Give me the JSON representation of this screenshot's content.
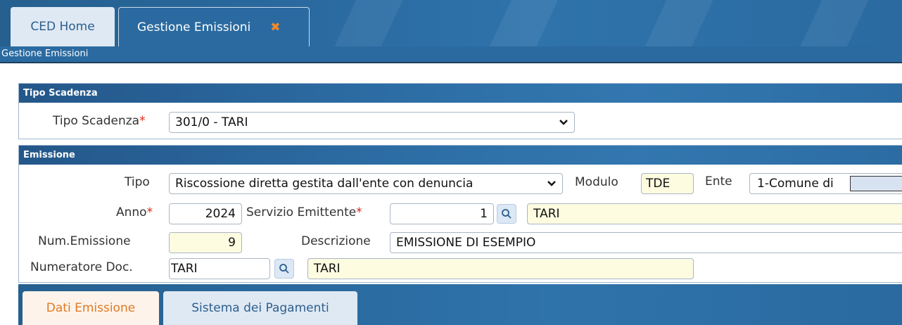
{
  "tabs": {
    "home_label": "CED Home",
    "active_label": "Gestione Emissioni",
    "close_glyph": "✖"
  },
  "breadcrumb": "Gestione Emissioni",
  "tipo_scadenza_panel": {
    "title": "Tipo Scadenza",
    "field_label": "Tipo Scadenza",
    "required_mark": "*",
    "value": "301/0 - TARI"
  },
  "emissione_panel": {
    "title": "Emissione",
    "tipo_label": "Tipo",
    "tipo_value": "Riscossione diretta gestita dall'ente con denuncia",
    "modulo_label": "Modulo",
    "modulo_value": "TDE",
    "ente_label": "Ente",
    "ente_value": "1-Comune di",
    "anno_label": "Anno",
    "anno_value": "2024",
    "servizio_label": "Servizio Emittente",
    "servizio_code": "1",
    "servizio_desc": "TARI",
    "num_label": "Num.Emissione",
    "num_value": "9",
    "descrizione_label": "Descrizione",
    "descrizione_value": "EMISSIONE DI ESEMPIO",
    "numeratore_label": "Numeratore Doc.",
    "numeratore_code": "TARI",
    "numeratore_desc": "TARI",
    "required_mark": "*"
  },
  "bottom_tabs": {
    "dati_label": "Dati Emissione",
    "sistema_label": "Sistema dei Pagamenti"
  },
  "colors": {
    "header_blue": "#2a6aa0",
    "required_red": "#d9281b",
    "active_tab_orange": "#e07a24",
    "readonly_yellow": "#fdfbe0"
  }
}
